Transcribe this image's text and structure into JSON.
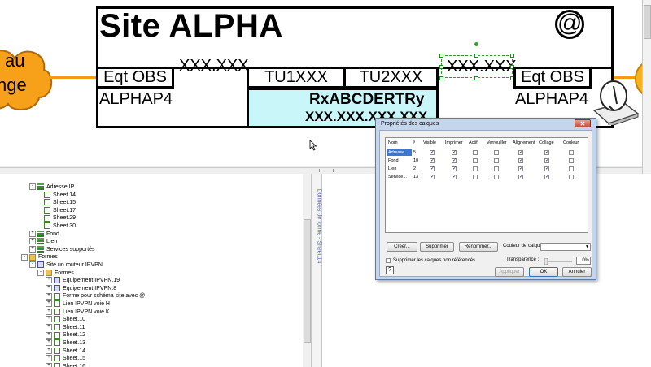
{
  "diagram": {
    "cloud_text_line1": "au",
    "cloud_text_line2": "nge",
    "site_title": "Site ALPHA",
    "at_symbol": "@",
    "left_box_label": "Eqt OBS",
    "left_box_name": "ALPHAP4",
    "left_xxx": "XXX.XXX",
    "tu1": "TU1XXX",
    "tu2": "TU2XXX",
    "right_xxx": "XXX.XXX",
    "right_box_label": "Eqt OBS",
    "right_box_name": "ALPHAP4",
    "rx_text": "RxABCDERTRy",
    "ip_text": "XXX.XXX.XXX.XXX"
  },
  "tree": {
    "rows": [
      {
        "indent": 1,
        "expander": "-",
        "icon": "layer",
        "label": "Adresse IP"
      },
      {
        "indent": 2,
        "expander": "",
        "icon": "sheet",
        "label": "Sheet.14"
      },
      {
        "indent": 2,
        "expander": "",
        "icon": "sheet",
        "label": "Sheet.15"
      },
      {
        "indent": 2,
        "expander": "",
        "icon": "sheet",
        "label": "Sheet.17"
      },
      {
        "indent": 2,
        "expander": "",
        "icon": "sheet",
        "label": "Sheet.29"
      },
      {
        "indent": 2,
        "expander": "",
        "icon": "sheet",
        "label": "Sheet.30"
      },
      {
        "indent": 1,
        "expander": "+",
        "icon": "layer",
        "label": "Fond"
      },
      {
        "indent": 1,
        "expander": "+",
        "icon": "layer",
        "label": "Lien"
      },
      {
        "indent": 1,
        "expander": "+",
        "icon": "layer",
        "label": "Services supportés"
      },
      {
        "indent": 0,
        "expander": "-",
        "icon": "folder",
        "label": "Formes"
      },
      {
        "indent": 1,
        "expander": "-",
        "icon": "shape",
        "label": "Site un routeur IPVPN"
      },
      {
        "indent": 2,
        "expander": "-",
        "icon": "folder",
        "label": "Formes"
      },
      {
        "indent": 3,
        "expander": "+",
        "icon": "shape",
        "label": "Equipement IPVPN.19"
      },
      {
        "indent": 3,
        "expander": "+",
        "icon": "shape",
        "label": "Equipement IPVPN.8"
      },
      {
        "indent": 3,
        "expander": "+",
        "icon": "sheet",
        "label": "Forme pour schéma site avec @"
      },
      {
        "indent": 3,
        "expander": "+",
        "icon": "sheet",
        "label": "Lien IPVPN voie H"
      },
      {
        "indent": 3,
        "expander": "+",
        "icon": "sheet",
        "label": "Lien IPVPN voie K"
      },
      {
        "indent": 3,
        "expander": "+",
        "icon": "sheet",
        "label": "Sheet.10"
      },
      {
        "indent": 3,
        "expander": "+",
        "icon": "sheet",
        "label": "Sheet.11"
      },
      {
        "indent": 3,
        "expander": "+",
        "icon": "sheet",
        "label": "Sheet.12"
      },
      {
        "indent": 3,
        "expander": "+",
        "icon": "sheet",
        "label": "Sheet.13"
      },
      {
        "indent": 3,
        "expander": "+",
        "icon": "sheet",
        "label": "Sheet.14"
      },
      {
        "indent": 3,
        "expander": "+",
        "icon": "sheet",
        "label": "Sheet.15"
      },
      {
        "indent": 3,
        "expander": "+",
        "icon": "sheet",
        "label": "Sheet.16"
      }
    ]
  },
  "side_tab_label": "Données de forme - Sheet.14",
  "dialog": {
    "title": "Propriétés des calques",
    "close_label": "✕",
    "columns": [
      "Nom",
      "#",
      "Visible",
      "Imprimer",
      "Actif",
      "Verrouiller",
      "Alignement",
      "Collage",
      "Couleur"
    ],
    "rows": [
      {
        "name": "Adresse...",
        "count": "5",
        "checks": [
          true,
          true,
          false,
          false,
          true,
          true,
          false
        ]
      },
      {
        "name": "Fond",
        "count": "10",
        "checks": [
          true,
          true,
          false,
          false,
          true,
          true,
          false
        ]
      },
      {
        "name": "Lien",
        "count": "2",
        "checks": [
          true,
          true,
          false,
          false,
          true,
          true,
          false
        ]
      },
      {
        "name": "Service...",
        "count": "13",
        "checks": [
          true,
          true,
          false,
          false,
          true,
          true,
          false
        ]
      }
    ],
    "new_button": "Créer...",
    "delete_button": "Supprimer",
    "rename_button": "Renommer...",
    "color_label": "Couleur de calque :",
    "color_value": "",
    "remove_unref_label": "Supprimer les calques non référencés",
    "transparency_label": "Transparence :",
    "transparency_value": "0%",
    "apply_button": "Appliquer",
    "ok_button": "OK",
    "cancel_button": "Annuler"
  }
}
